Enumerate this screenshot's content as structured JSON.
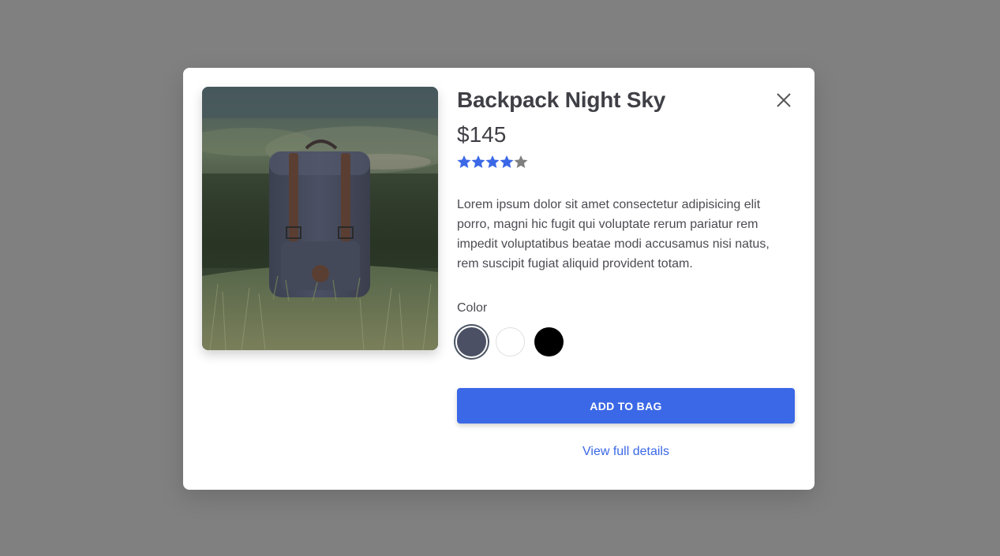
{
  "product": {
    "title": "Backpack Night Sky",
    "price": "$145",
    "rating": 4,
    "rating_max": 5,
    "description": "Lorem ipsum dolor sit amet consectetur adipisicing elit porro, magni hic fugit qui voluptate rerum pariatur rem impedit voluptatibus beatae modi accusamus nisi natus, rem suscipit fugiat aliquid provident totam.",
    "color_label": "Color",
    "colors": [
      {
        "name": "night-sky",
        "hex": "#4b5064",
        "selected": true
      },
      {
        "name": "white",
        "hex": "#ffffff",
        "selected": false
      },
      {
        "name": "black",
        "hex": "#000000",
        "selected": false
      }
    ],
    "add_to_bag_label": "ADD TO BAG",
    "view_details_label": "View full details"
  },
  "icons": {
    "close": "close-icon",
    "star": "star-icon"
  },
  "theme": {
    "accent": "#3b68e6",
    "star_filled": "#3b68e6",
    "star_empty": "#808080",
    "backdrop": "#808080"
  }
}
